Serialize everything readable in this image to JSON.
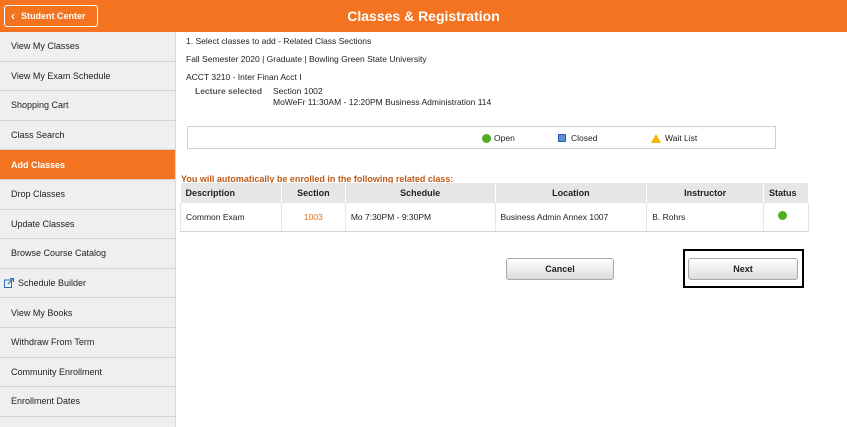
{
  "header": {
    "back_label": "Student Center",
    "title": "Classes & Registration"
  },
  "colors": {
    "brand": "#f37321",
    "open": "#4caf1f",
    "closed": "#5b8fd6",
    "waitlist": "#f5b400"
  },
  "sidebar": {
    "items": [
      {
        "label": "View My Classes"
      },
      {
        "label": "View My Exam Schedule"
      },
      {
        "label": "Shopping Cart"
      },
      {
        "label": "Class Search"
      },
      {
        "label": "Add Classes",
        "active": true
      },
      {
        "label": "Drop Classes"
      },
      {
        "label": "Update Classes"
      },
      {
        "label": "Browse Course Catalog"
      },
      {
        "label": "Schedule Builder",
        "icon": "external-link-icon"
      },
      {
        "label": "View My Books"
      },
      {
        "label": "Withdraw From Term"
      },
      {
        "label": "Community Enrollment"
      },
      {
        "label": "Enrollment Dates"
      }
    ]
  },
  "main": {
    "step": "1.  Select classes to add - Related Class Sections",
    "term": "Fall Semester 2020 | Graduate | Bowling Green State University",
    "course": "ACCT 3210 - Inter Finan Acct I",
    "lecture_label": "Lecture selected",
    "lecture_section": "Section 1002",
    "lecture_schedule": "MoWeFr 11:30AM - 12:20PM   Business Administration 114",
    "legend": {
      "open": "Open",
      "closed": "Closed",
      "waitlist": "Wait List"
    },
    "notice": "You will automatically be enrolled in the following related class:",
    "table": {
      "headers": [
        "Description",
        "Section",
        "Schedule",
        "Location",
        "Instructor",
        "Status"
      ],
      "rows": [
        {
          "description": "Common Exam",
          "section": "1003",
          "schedule": "Mo 7:30PM - 9:30PM",
          "location": "Business Admin Annex 1007",
          "instructor": "B. Rohrs",
          "status": "Open"
        }
      ]
    },
    "cancel_label": "Cancel",
    "next_label": "Next"
  }
}
